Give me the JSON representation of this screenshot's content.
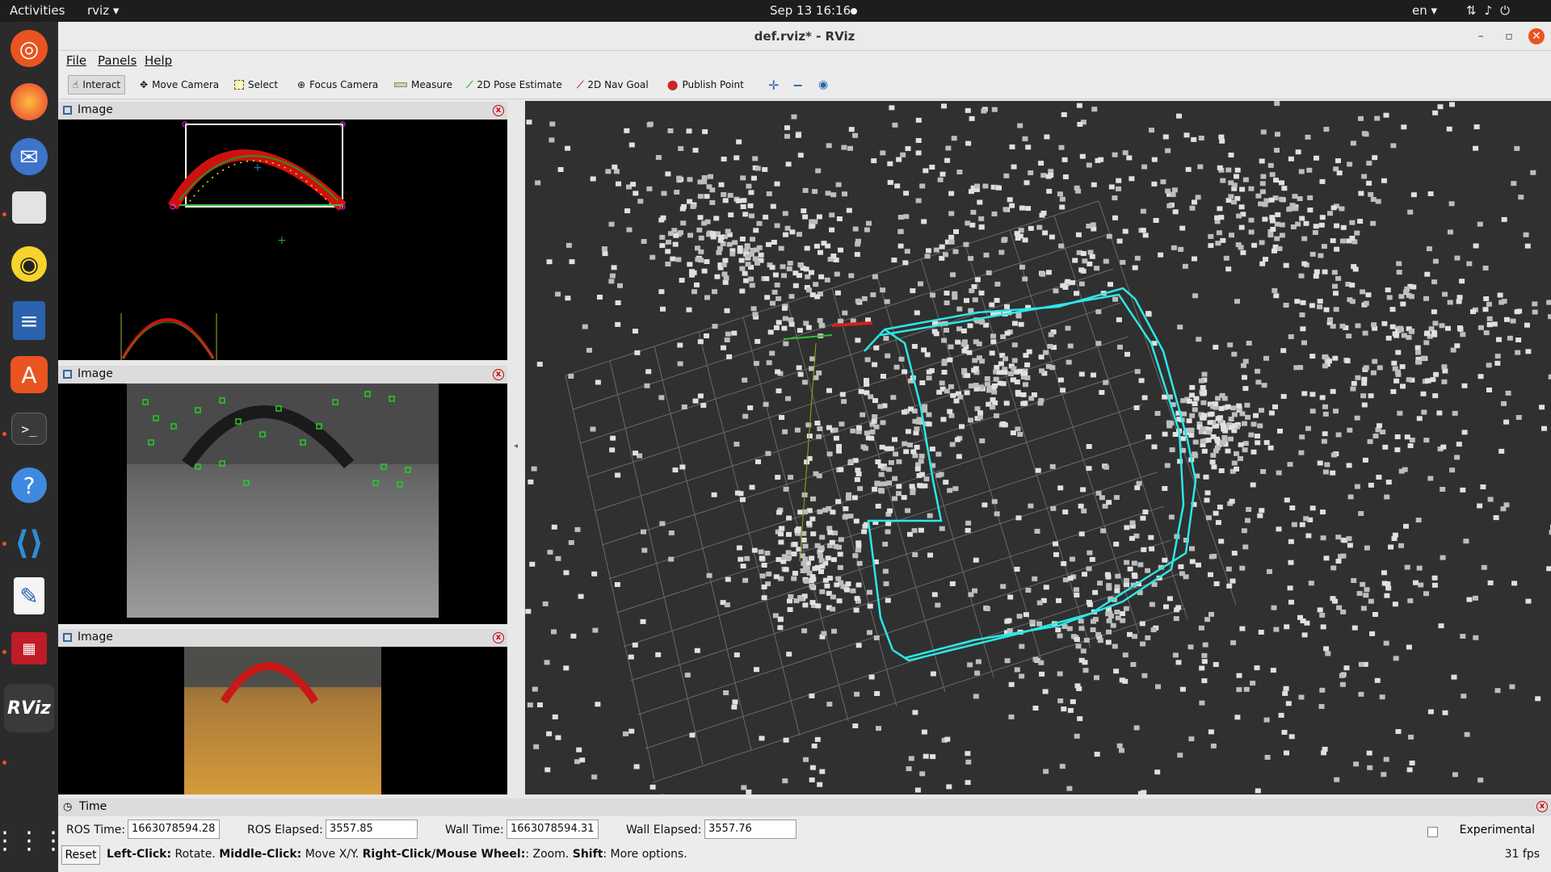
{
  "topbar": {
    "activities": "Activities",
    "app_name": "rviz ▾",
    "clock": "Sep 13  16:16",
    "lang": "en ▾",
    "tray_icons": [
      "network-icon",
      "volume-icon",
      "power-icon"
    ]
  },
  "dock": {
    "items": [
      "ubuntu-icon",
      "firefox-icon",
      "thunderbird-icon",
      "files-icon",
      "rhythmbox-icon",
      "writer-icon",
      "software-icon",
      "terminal-icon",
      "help-icon",
      "vscode-icon",
      "text-editor-icon",
      "app-icon",
      "rviz-icon",
      "apps-grid-icon"
    ]
  },
  "window": {
    "title": "def.rviz* - RViz",
    "menu": {
      "file": "File",
      "panels": "Panels",
      "help": "Help"
    },
    "toolbar": {
      "interact": "Interact",
      "move_camera": "Move Camera",
      "select": "Select",
      "focus_camera": "Focus Camera",
      "measure": "Measure",
      "pose_estimate": "2D Pose Estimate",
      "nav_goal": "2D Nav Goal",
      "publish_point": "Publish Point"
    },
    "panels": [
      {
        "title": "Image"
      },
      {
        "title": "Image"
      },
      {
        "title": "Image"
      }
    ],
    "time_panel": {
      "title": "Time",
      "ros_time_label": "ROS Time:",
      "ros_time": "1663078594.28",
      "ros_elapsed_label": "ROS Elapsed:",
      "ros_elapsed": "3557.85",
      "wall_time_label": "Wall Time:",
      "wall_time": "1663078594.31",
      "wall_elapsed_label": "Wall Elapsed:",
      "wall_elapsed": "3557.76",
      "experimental": "Experimental",
      "reset": "Reset",
      "hint_left_click": "Left-Click:",
      "hint_rotate": " Rotate. ",
      "hint_middle_click": "Middle-Click:",
      "hint_move": " Move X/Y. ",
      "hint_right_click": "Right-Click/Mouse Wheel:",
      "hint_zoom": ": Zoom. ",
      "hint_shift": "Shift",
      "hint_more": ": More options.",
      "fps": "31 fps"
    }
  },
  "colors": {
    "accent": "#e95420",
    "trajectory": "#2ee6e6",
    "point_cloud": "#d8d8d8",
    "view_bg": "#303030"
  }
}
